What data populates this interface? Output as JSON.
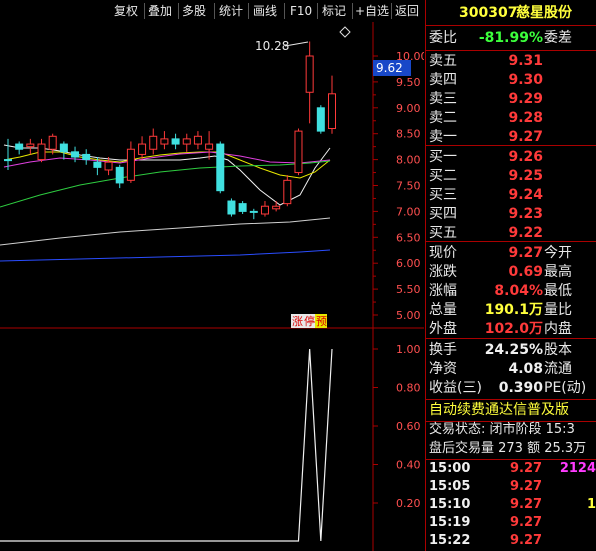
{
  "toolbar": {
    "buttons": [
      "复权",
      "叠加",
      "多股",
      "统计",
      "画线",
      "F10",
      "标记",
      "+自选",
      "返回"
    ]
  },
  "chart": {
    "max_marker": "10.28",
    "current_price_tag": "9.62",
    "price_axis": [
      "10.00",
      "9.50",
      "9.00",
      "8.50",
      "8.00",
      "7.50",
      "7.00",
      "6.50",
      "6.00",
      "5.50",
      "5.00"
    ],
    "indicator_axis": [
      "1.00",
      "0.80",
      "0.60",
      "0.40",
      "0.20"
    ],
    "badges": {
      "b1": "涨",
      "b2": "停",
      "b3": "预"
    },
    "chart_data": {
      "type": "candlestick",
      "ylim": [
        4.95,
        10.35
      ],
      "candles": [
        {
          "o": 8.0,
          "c": 8.0,
          "h": 8.4,
          "l": 7.8,
          "up": false
        },
        {
          "o": 8.3,
          "c": 8.2,
          "h": 8.35,
          "l": 8.1,
          "up": false
        },
        {
          "o": 8.25,
          "c": 8.3,
          "h": 8.4,
          "l": 8.1,
          "up": true
        },
        {
          "o": 8.0,
          "c": 8.3,
          "h": 8.4,
          "l": 7.95,
          "up": true
        },
        {
          "o": 8.2,
          "c": 8.45,
          "h": 8.5,
          "l": 8.1,
          "up": true
        },
        {
          "o": 8.15,
          "c": 8.3,
          "h": 8.35,
          "l": 8.0,
          "up": false
        },
        {
          "o": 8.05,
          "c": 8.15,
          "h": 8.25,
          "l": 7.95,
          "up": false
        },
        {
          "o": 8.0,
          "c": 8.1,
          "h": 8.2,
          "l": 7.9,
          "up": false
        },
        {
          "o": 7.95,
          "c": 7.85,
          "h": 8.05,
          "l": 7.7,
          "up": false
        },
        {
          "o": 7.8,
          "c": 7.95,
          "h": 8.05,
          "l": 7.7,
          "up": true
        },
        {
          "o": 7.55,
          "c": 7.85,
          "h": 7.9,
          "l": 7.45,
          "up": false
        },
        {
          "o": 7.6,
          "c": 8.2,
          "h": 8.35,
          "l": 7.55,
          "up": true
        },
        {
          "o": 8.1,
          "c": 8.3,
          "h": 8.45,
          "l": 8.0,
          "up": true
        },
        {
          "o": 8.2,
          "c": 8.45,
          "h": 8.6,
          "l": 8.1,
          "up": true
        },
        {
          "o": 8.3,
          "c": 8.4,
          "h": 8.55,
          "l": 8.2,
          "up": true
        },
        {
          "o": 8.3,
          "c": 8.4,
          "h": 8.5,
          "l": 8.2,
          "up": false
        },
        {
          "o": 8.3,
          "c": 8.4,
          "h": 8.5,
          "l": 8.15,
          "up": true
        },
        {
          "o": 8.3,
          "c": 8.45,
          "h": 8.55,
          "l": 8.2,
          "up": true
        },
        {
          "o": 8.2,
          "c": 8.3,
          "h": 8.55,
          "l": 8.0,
          "up": true
        },
        {
          "o": 8.3,
          "c": 7.4,
          "h": 8.35,
          "l": 7.35,
          "up": false
        },
        {
          "o": 7.2,
          "c": 6.95,
          "h": 7.25,
          "l": 6.9,
          "up": false
        },
        {
          "o": 7.15,
          "c": 7.0,
          "h": 7.2,
          "l": 6.95,
          "up": false
        },
        {
          "o": 7.0,
          "c": 7.0,
          "h": 7.05,
          "l": 6.85,
          "up": false
        },
        {
          "o": 6.95,
          "c": 7.1,
          "h": 7.2,
          "l": 6.9,
          "up": true
        },
        {
          "o": 7.05,
          "c": 7.1,
          "h": 7.2,
          "l": 7.0,
          "up": true
        },
        {
          "o": 7.15,
          "c": 7.6,
          "h": 7.7,
          "l": 7.1,
          "up": true
        },
        {
          "o": 7.75,
          "c": 8.55,
          "h": 8.6,
          "l": 7.7,
          "up": true
        },
        {
          "o": 9.3,
          "c": 10.0,
          "h": 10.28,
          "l": 8.7,
          "up": true
        },
        {
          "o": 9.0,
          "c": 8.55,
          "h": 9.05,
          "l": 8.5,
          "up": false
        },
        {
          "o": 8.6,
          "c": 9.27,
          "h": 9.62,
          "l": 8.5,
          "up": true
        }
      ],
      "indicator": {
        "values": [
          0,
          0,
          0,
          0,
          0,
          0,
          0,
          0,
          0,
          0,
          0,
          0,
          0,
          0,
          0,
          0,
          0,
          0,
          0,
          0,
          0,
          0,
          0,
          0,
          0,
          0,
          0,
          1,
          0,
          1
        ],
        "ylim": [
          0.05,
          1.0
        ]
      }
    }
  },
  "quote": {
    "code": "300307",
    "name": "慈星股份",
    "weibi_label": "委比",
    "weibi_value": "-81.99%",
    "weicha_label": "委差",
    "sell": [
      {
        "label": "卖五",
        "price": "9.31"
      },
      {
        "label": "卖四",
        "price": "9.30"
      },
      {
        "label": "卖三",
        "price": "9.29"
      },
      {
        "label": "卖二",
        "price": "9.28"
      },
      {
        "label": "卖一",
        "price": "9.27"
      }
    ],
    "buy": [
      {
        "label": "买一",
        "price": "9.26"
      },
      {
        "label": "买二",
        "price": "9.25"
      },
      {
        "label": "买三",
        "price": "9.24"
      },
      {
        "label": "买四",
        "price": "9.23"
      },
      {
        "label": "买五",
        "price": "9.22"
      }
    ],
    "stats": [
      {
        "label": "现价",
        "value": "9.27",
        "label2": "今开"
      },
      {
        "label": "涨跌",
        "value": "0.69",
        "label2": "最高"
      },
      {
        "label": "涨幅",
        "value": "8.04%",
        "label2": "最低"
      },
      {
        "label": "总量",
        "value": "190.1万",
        "label2": "量比"
      },
      {
        "label": "外盘",
        "value": "102.0万",
        "label2": "内盘"
      }
    ],
    "stats2": [
      {
        "label": "换手",
        "value": "24.25%",
        "label2": "股本"
      },
      {
        "label": "净资",
        "value": "4.08",
        "label2": "流通"
      },
      {
        "label": "收益(三)",
        "value": "0.390",
        "label2": "PE(动)"
      }
    ],
    "banner": "自动续费通达信普及版",
    "trade_status": "交易状态: 闭市阶段 15:3",
    "after_hours": "盘后交易量 273 额 25.3万",
    "ticks": [
      {
        "time": "15:00",
        "price": "9.27",
        "vol": "2124"
      },
      {
        "time": "15:05",
        "price": "9.27",
        "vol": ""
      },
      {
        "time": "15:10",
        "price": "9.27",
        "vol": "1"
      },
      {
        "time": "15:19",
        "price": "9.27",
        "vol": ""
      },
      {
        "time": "15:22",
        "price": "9.27",
        "vol": ""
      }
    ]
  }
}
